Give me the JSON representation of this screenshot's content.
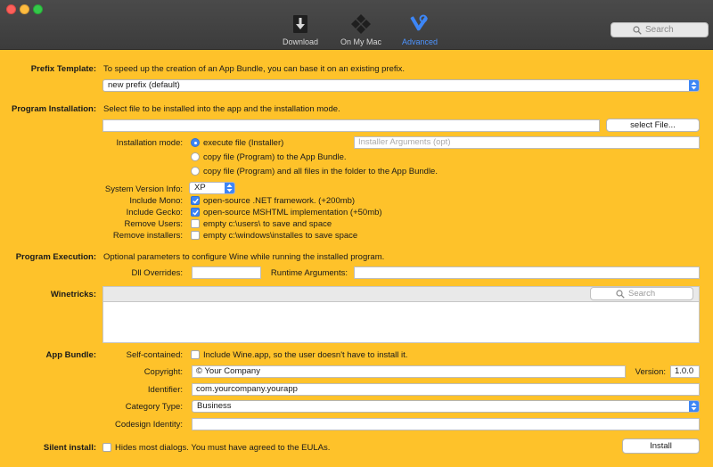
{
  "toolbar": {
    "items": [
      {
        "label": "Download",
        "icon": "download-icon"
      },
      {
        "label": "On My Mac",
        "icon": "on-my-mac-icon"
      },
      {
        "label": "Advanced",
        "icon": "advanced-tools-icon"
      }
    ],
    "selected": "Advanced",
    "search_placeholder": "Search"
  },
  "prefix": {
    "label": "Prefix Template:",
    "description": "To speed up the creation of an App Bundle, you can base it on an existing prefix.",
    "selected": "new prefix (default)"
  },
  "program_installation": {
    "label": "Program Installation:",
    "description": "Select file to be installed into the app and the installation mode.",
    "file_value": "",
    "select_button": "select File...",
    "mode_label": "Installation mode:",
    "modes": [
      "execute file (Installer)",
      "copy file (Program)  to the App Bundle.",
      "copy file (Program)  and all files in the folder to the App Bundle."
    ],
    "selected_mode": 0,
    "installer_args_placeholder": "Installer Arguments (opt)",
    "system_version_label": "System Version Info:",
    "system_version": "XP",
    "options": [
      {
        "label": "Include Mono:",
        "text": "open-source .NET framework. (+200mb)",
        "checked": true
      },
      {
        "label": "Include Gecko:",
        "text": "open-source MSHTML implementation (+50mb)",
        "checked": true
      },
      {
        "label": "Remove Users:",
        "text": "empty c:\\users\\ to save and space",
        "checked": false
      },
      {
        "label": "Remove installers:",
        "text": "empty c:\\windows\\installes to save space",
        "checked": false
      }
    ]
  },
  "program_execution": {
    "label": "Program Execution:",
    "description": "Optional parameters to configure Wine while running the installed program.",
    "dll_label": "Dll Overrides:",
    "dll_value": "",
    "runtime_label": "Runtime Arguments:",
    "runtime_value": ""
  },
  "winetricks": {
    "label": "Winetricks:",
    "search_placeholder": "Search"
  },
  "app_bundle": {
    "label": "App Bundle:",
    "self_contained_label": "Self-contained:",
    "self_contained_text": "Include Wine.app, so the user doesn't have to install it.",
    "self_contained_checked": false,
    "copyright_label": "Copyright:",
    "copyright_value": "© Your Company",
    "version_label": "Version:",
    "version_value": "1.0.0",
    "identifier_label": "Identifier:",
    "identifier_value": "com.yourcompany.yourapp",
    "category_label": "Category Type:",
    "category_value": "Business",
    "codesign_label": "Codesign Identity:",
    "codesign_value": ""
  },
  "silent_install": {
    "label": "Silent install:",
    "text": "Hides most dialogs. You must have agreed to the EULAs.",
    "checked": false
  },
  "install_button": "Install",
  "colors": {
    "background": "#fec22a",
    "accent": "#3d86f6",
    "titlebar": "#404040"
  }
}
